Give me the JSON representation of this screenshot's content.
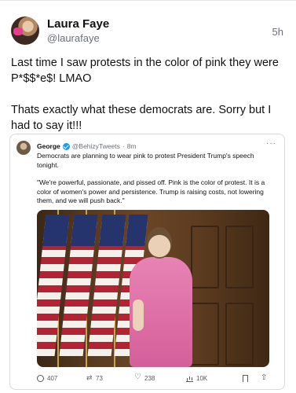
{
  "post": {
    "author_name": "Laura Faye",
    "author_handle": "@laurafaye",
    "timestamp": "5h",
    "paragraphs": [
      "Last time I saw protests in the color of pink they were P*$$*e$! LMAO",
      "Thats exactly what these democrats are. Sorry but I had to say it!!!"
    ]
  },
  "embedded_tweet": {
    "author_name": "George",
    "author_handle": "@BehizyTweets",
    "separator": "·",
    "timestamp": "8m",
    "more_icon": "more-dots-icon",
    "paragraphs": [
      "Democrats are planning to wear pink to protest President Trump's speech tonight.",
      "\"We're powerful, passionate, and pissed off. Pink is the color of protest. It is a color of women's power and persistence. Trump is raising costs, not lowering them, and we will push back.\""
    ],
    "actions": {
      "replies": "407",
      "retweets": "73",
      "likes": "238",
      "views": "10K"
    }
  },
  "colors": {
    "verified_badge": "#1d9bf0",
    "text_primary": "#0f1419",
    "text_secondary": "#6b7076"
  }
}
